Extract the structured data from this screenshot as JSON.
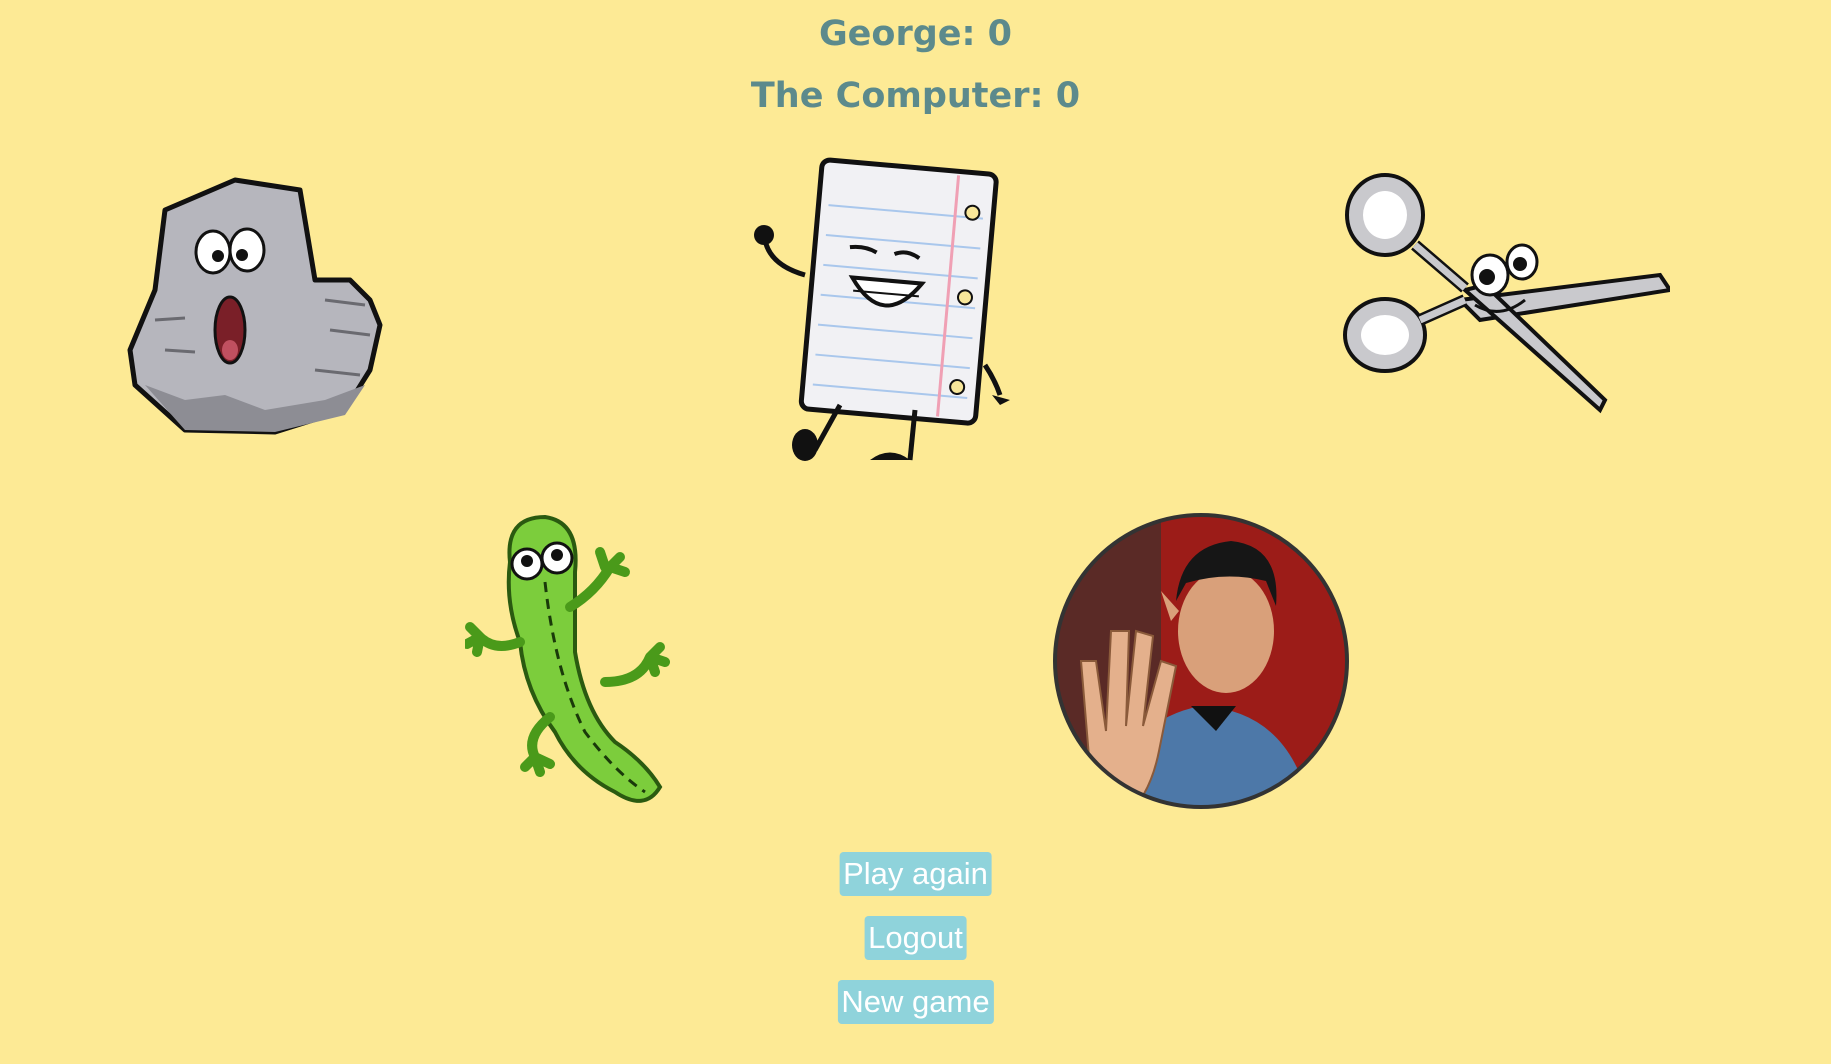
{
  "scores": {
    "player": "George: 0",
    "computer": "The Computer: 0"
  },
  "choices": [
    {
      "name": "rock-icon",
      "label": "Rock"
    },
    {
      "name": "paper-icon",
      "label": "Paper"
    },
    {
      "name": "scissors-icon",
      "label": "Scissors"
    },
    {
      "name": "lizard-icon",
      "label": "Lizard"
    },
    {
      "name": "spock-icon",
      "label": "Spock"
    }
  ],
  "buttons": {
    "play_again": "Play again",
    "logout": "Logout",
    "new_game": "New game"
  },
  "colors": {
    "background": "#fdea95",
    "score_text": "#5c8a8c",
    "button_bg": "#8fd3db",
    "button_text": "#ffffff"
  }
}
